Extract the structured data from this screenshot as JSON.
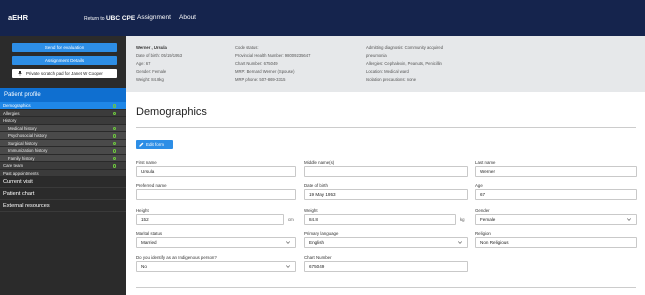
{
  "topbar": {
    "brand": "aEHR",
    "return_prefix": "Return to ",
    "return_org": "UBC CPE",
    "nav": [
      "Assignment",
      "About"
    ]
  },
  "sidebar": {
    "send_eval": "Send for evaluation",
    "assignment_details": "Assignment Details",
    "scratch_pad": "Private scratch pad for Janet W Cooper",
    "patient_profile": "Patient profile",
    "items": [
      {
        "label": "Demographics",
        "active": true,
        "dot": true
      },
      {
        "label": "Allergies",
        "active": false,
        "dot": true
      },
      {
        "label": "History",
        "active": false,
        "dot": false
      },
      {
        "label": "Medical history",
        "sub": true,
        "dot": true
      },
      {
        "label": "Psychosocial history",
        "sub": true,
        "dot": true
      },
      {
        "label": "Surgical history",
        "sub": true,
        "dot": true
      },
      {
        "label": "Immunization history",
        "sub": true,
        "dot": true
      },
      {
        "label": "Family history",
        "sub": true,
        "dot": true
      },
      {
        "label": "Care team",
        "active": false,
        "dot": true
      },
      {
        "label": "Past appointments",
        "active": false,
        "dot": false
      }
    ],
    "sections": [
      "Current visit",
      "Patient chart",
      "External resources"
    ]
  },
  "banner": {
    "col1": [
      "Werner , Ursula",
      "Date of birth: 05/19/1953",
      "Age: 67",
      "Gender: Female",
      "Weight: 84.8kg"
    ],
    "col2": [
      "Code status:",
      "Provincial Health Number: 98009235647",
      "Chart Number: 675049",
      "MRP: Bernard Werner (Spouse)",
      "MRP phone: 507-869-3315"
    ],
    "col3": [
      "Admitting diagnosis: Community acquired",
      "pneumonia",
      "Allergies: Cephalexin, Peanuts, Penicillin",
      "Location: Medical ward",
      "Isolation precautions: none"
    ]
  },
  "page_title": "Demographics",
  "edit_form": "Edit form",
  "form": {
    "first_name": {
      "label": "First name",
      "value": "Ursula"
    },
    "middle_name": {
      "label": "Middle name(s)",
      "value": ""
    },
    "last_name": {
      "label": "Last name",
      "value": "Werner"
    },
    "preferred_name": {
      "label": "Preferred name",
      "value": ""
    },
    "dob": {
      "label": "Date of birth",
      "value": "19 May 1953"
    },
    "age": {
      "label": "Age",
      "value": "67"
    },
    "height": {
      "label": "Height",
      "value": "152",
      "unit": "cm"
    },
    "weight": {
      "label": "Weight",
      "value": "84.8",
      "unit": "kg"
    },
    "gender": {
      "label": "Gender",
      "value": "Female"
    },
    "marital": {
      "label": "Marital status",
      "value": "Married"
    },
    "language": {
      "label": "Primary language",
      "value": "English"
    },
    "religion": {
      "label": "Religion",
      "value": "Non Religious"
    },
    "indigenous": {
      "label": "Do you identify as an Indigenous person?",
      "value": "No"
    },
    "chart_number": {
      "label": "Chart Number",
      "value": "675049"
    }
  },
  "colors": {
    "nav": "#15244d",
    "accent": "#2d8ee6",
    "active": "#1f87e8",
    "sidebar": "#2b2b2b",
    "dot": "#6ecb3e"
  }
}
